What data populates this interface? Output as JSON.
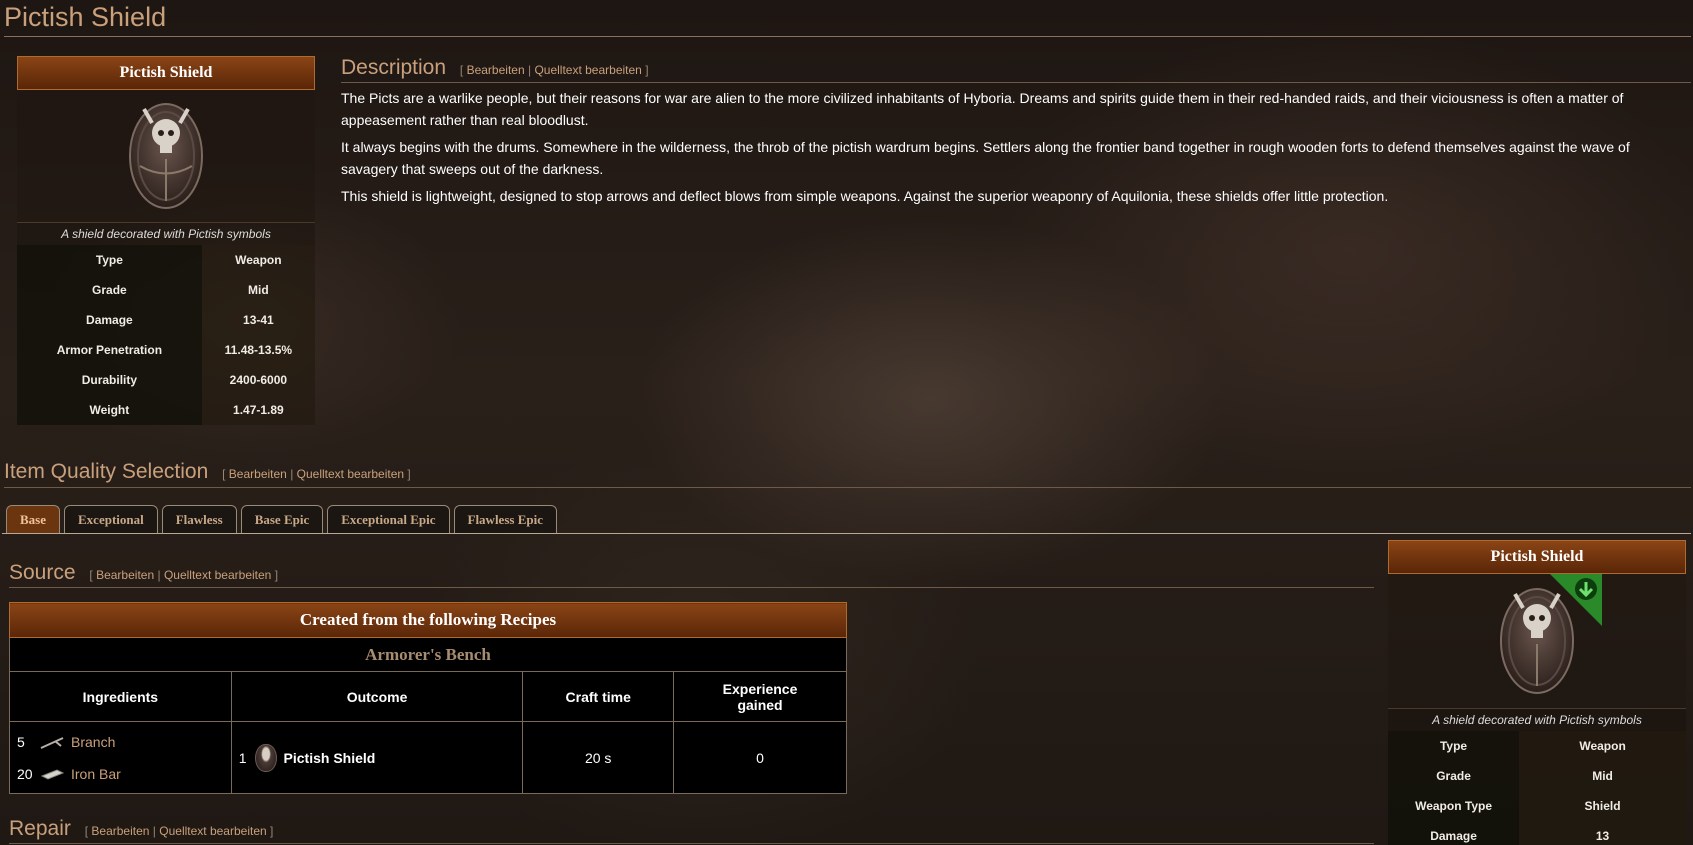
{
  "page": {
    "title": "Pictish Shield"
  },
  "colors": {
    "accent": "#c9a07c",
    "header": "#7a3a10",
    "tab_active": "#6b3510"
  },
  "infobox_top": {
    "title": "Pictish Shield",
    "caption": "A shield decorated with Pictish symbols",
    "rows": [
      {
        "key": "Type",
        "value": "Weapon"
      },
      {
        "key": "Grade",
        "value": "Mid"
      },
      {
        "key": "Damage",
        "value": "13-41"
      },
      {
        "key": "Armor Penetration",
        "value": "11.48-13.5%"
      },
      {
        "key": "Durability",
        "value": "2400-6000"
      },
      {
        "key": "Weight",
        "value": "1.47-1.89"
      }
    ]
  },
  "edit_links": {
    "edit": "Bearbeiten",
    "source_edit": "Quelltext bearbeiten",
    "sep": "|",
    "open": "[",
    "close": "]"
  },
  "description": {
    "heading": "Description",
    "paragraphs": [
      "The Picts are a warlike people, but their reasons for war are alien to the more civilized inhabitants of Hyboria. Dreams and spirits guide them in their red-handed raids, and their viciousness is often a matter of appeasement rather than real bloodlust.",
      "It always begins with the drums. Somewhere in the wilderness, the throb of the pictish wardrum begins. Settlers along the frontier band together in rough wooden forts to defend themselves against the wave of savagery that sweeps out of the darkness.",
      "This shield is lightweight, designed to stop arrows and deflect blows from simple weapons. Against the superior weaponry of Aquilonia, these shields offer little protection."
    ]
  },
  "quality": {
    "heading": "Item Quality Selection",
    "tabs": [
      "Base",
      "Exceptional",
      "Flawless",
      "Base Epic",
      "Exceptional Epic",
      "Flawless Epic"
    ],
    "active_tab": "Base"
  },
  "source": {
    "heading": "Source",
    "table_title": "Created from the following Recipes",
    "bench": "Armorer's Bench",
    "columns": [
      "Ingredients",
      "Outcome",
      "Craft time",
      "Experience gained"
    ],
    "ingredients": [
      {
        "qty": "5",
        "name": "Branch",
        "icon": "branch-icon"
      },
      {
        "qty": "20",
        "name": "Iron Bar",
        "icon": "iron-bar-icon"
      }
    ],
    "outcome": {
      "qty": "1",
      "name": "Pictish Shield",
      "icon": "pictish-shield-icon"
    },
    "craft_time": "20 s",
    "experience": "0"
  },
  "repair": {
    "heading": "Repair"
  },
  "infobox_side": {
    "title": "Pictish Shield",
    "caption": "A shield decorated with Pictish symbols",
    "badge_icon": "download-arrow-icon",
    "rows": [
      {
        "key": "Type",
        "value": "Weapon"
      },
      {
        "key": "Grade",
        "value": "Mid"
      },
      {
        "key": "Weapon Type",
        "value": "Shield"
      },
      {
        "key": "Damage",
        "value": "13"
      }
    ]
  }
}
